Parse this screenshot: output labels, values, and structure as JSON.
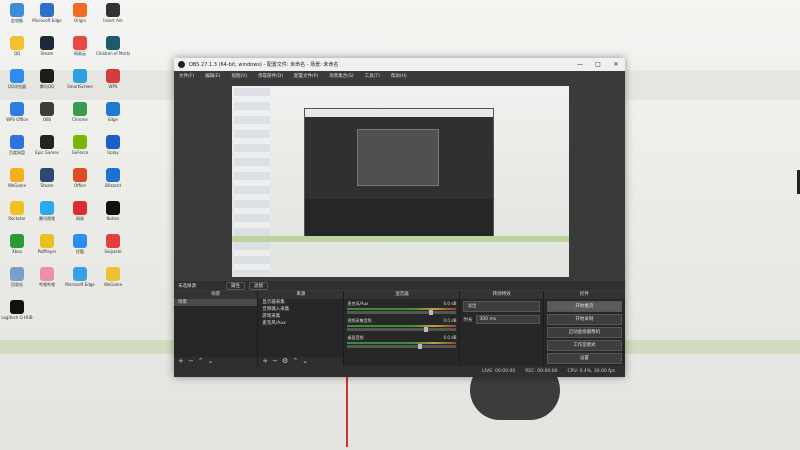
{
  "desktop": {
    "icons": [
      {
        "label": "此电脑",
        "color": "#3b8fd9"
      },
      {
        "label": "Microsoft Edge",
        "color": "#2f6fd0"
      },
      {
        "label": "Origin",
        "color": "#f06c22"
      },
      {
        "label": "Insert Ark",
        "color": "#333333"
      },
      {
        "label": "QQ",
        "color": "#f2c12e"
      },
      {
        "label": "Steam",
        "color": "#1b2838"
      },
      {
        "label": "网易云",
        "color": "#e94848"
      },
      {
        "label": "Children of Morta",
        "color": "#1e5a6a"
      },
      {
        "label": "QQ浏览器",
        "color": "#2e8bf0"
      },
      {
        "label": "腾讯QQ",
        "color": "#1c1c1c"
      },
      {
        "label": "SmartScreen",
        "color": "#2fa0e0"
      },
      {
        "label": "WPS",
        "color": "#d33c3c"
      },
      {
        "label": "WPS Office",
        "color": "#2d7de0"
      },
      {
        "label": "OBS",
        "color": "#3c3c3c"
      },
      {
        "label": "Chrome",
        "color": "#3b9a4b"
      },
      {
        "label": "Edge",
        "color": "#1e7ad0"
      },
      {
        "label": "百度网盘",
        "color": "#2b74e0"
      },
      {
        "label": "Epic Games",
        "color": "#222222"
      },
      {
        "label": "GeForce",
        "color": "#76b900"
      },
      {
        "label": "Uplay",
        "color": "#1a60c8"
      },
      {
        "label": "WeGame",
        "color": "#f0b020"
      },
      {
        "label": "Steam",
        "color": "#2c4a70"
      },
      {
        "label": "Office",
        "color": "#e04a2a"
      },
      {
        "label": "Blizzard",
        "color": "#1b72d0"
      },
      {
        "label": "Rockstar",
        "color": "#f0c020"
      },
      {
        "label": "腾讯视频",
        "color": "#2ea8f0"
      },
      {
        "label": "网易",
        "color": "#d93030"
      },
      {
        "label": "Notion",
        "color": "#111111"
      },
      {
        "label": "Xbox",
        "color": "#2a9a3a"
      },
      {
        "label": "PotPlayer",
        "color": "#e8c020"
      },
      {
        "label": "优酷",
        "color": "#2a8ff0"
      },
      {
        "label": "Snipaste",
        "color": "#e04040"
      },
      {
        "label": "回收站",
        "color": "#7aa0c8"
      },
      {
        "label": "哔哩哔哩",
        "color": "#f08eb0"
      },
      {
        "label": "Microsoft Edge",
        "color": "#3aa0e8"
      },
      {
        "label": "WeGame",
        "color": "#f0c030"
      },
      {
        "label": "Logitech G HUB",
        "color": "#111111"
      }
    ]
  },
  "obs": {
    "window_title": "OBS 27.1.3 (64-bit, windows) - 配置文件: 未命名 - 场景: 未命名",
    "window_controls": [
      "—",
      "□",
      "✕"
    ],
    "menu": [
      "文件(F)",
      "编辑(E)",
      "视图(V)",
      "停靠部件(D)",
      "配置文件(P)",
      "场景集合(S)",
      "工具(T)",
      "帮助(H)"
    ],
    "source_bar": {
      "label": "未选择源",
      "props": "属性",
      "filters": "滤镜"
    },
    "docks": {
      "scenes": {
        "title": "场景",
        "items": [
          "场景"
        ]
      },
      "sources": {
        "title": "来源",
        "items": [
          "显示器采集",
          "音频输入采集",
          "游戏采集",
          "麦克风/Aux"
        ]
      },
      "mixer": {
        "title": "混音器",
        "channels": [
          {
            "name": "麦克风/Aux",
            "db": "0.0 dB",
            "level": 0.75
          },
          {
            "name": "视频采集音频",
            "db": "0.0 dB",
            "level": 0.7
          },
          {
            "name": "桌面音频",
            "db": "0.0 dB",
            "level": 0.65
          }
        ]
      },
      "transitions": {
        "title": "转场特效",
        "type": "淡出",
        "duration_label": "时长",
        "duration": "300 ms"
      },
      "controls": {
        "title": "控件",
        "buttons": [
          "开始推流",
          "开始录制",
          "启动虚拟摄像机",
          "工作室模式",
          "设置",
          "退出"
        ]
      }
    },
    "status": {
      "live": "LIVE: 00:00:00",
      "rec": "REC: 00:00:00",
      "cpu": "CPU: 0.4%, 30.00 fps"
    }
  }
}
